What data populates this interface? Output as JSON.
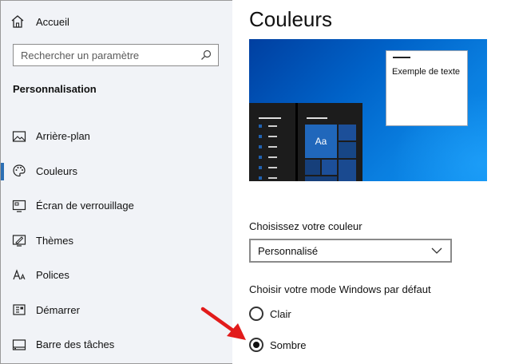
{
  "sidebar": {
    "home_label": "Accueil",
    "search_placeholder": "Rechercher un paramètre",
    "section_title": "Personnalisation",
    "items": [
      {
        "label": "Arrière-plan"
      },
      {
        "label": "Couleurs",
        "active": true
      },
      {
        "label": "Écran de verrouillage"
      },
      {
        "label": "Thèmes"
      },
      {
        "label": "Polices"
      },
      {
        "label": "Démarrer"
      },
      {
        "label": "Barre des tâches"
      }
    ]
  },
  "main": {
    "title": "Couleurs",
    "preview": {
      "tile_label": "Aa",
      "sample_text": "Exemple de texte"
    },
    "color_label": "Choisissez votre couleur",
    "color_value": "Personnalisé",
    "mode_label": "Choisir votre mode Windows par défaut",
    "modes": [
      {
        "label": "Clair",
        "selected": false
      },
      {
        "label": "Sombre",
        "selected": true
      }
    ]
  },
  "colors": {
    "accent": "#2c6fb4",
    "sidebar_bg": "#f1f3f7",
    "annotation_arrow": "#e21b1b"
  },
  "icons": [
    "home-icon",
    "search-icon",
    "image-icon",
    "palette-icon",
    "lock-screen-icon",
    "themes-icon",
    "fonts-icon",
    "start-icon",
    "taskbar-icon",
    "chevron-down-icon"
  ]
}
